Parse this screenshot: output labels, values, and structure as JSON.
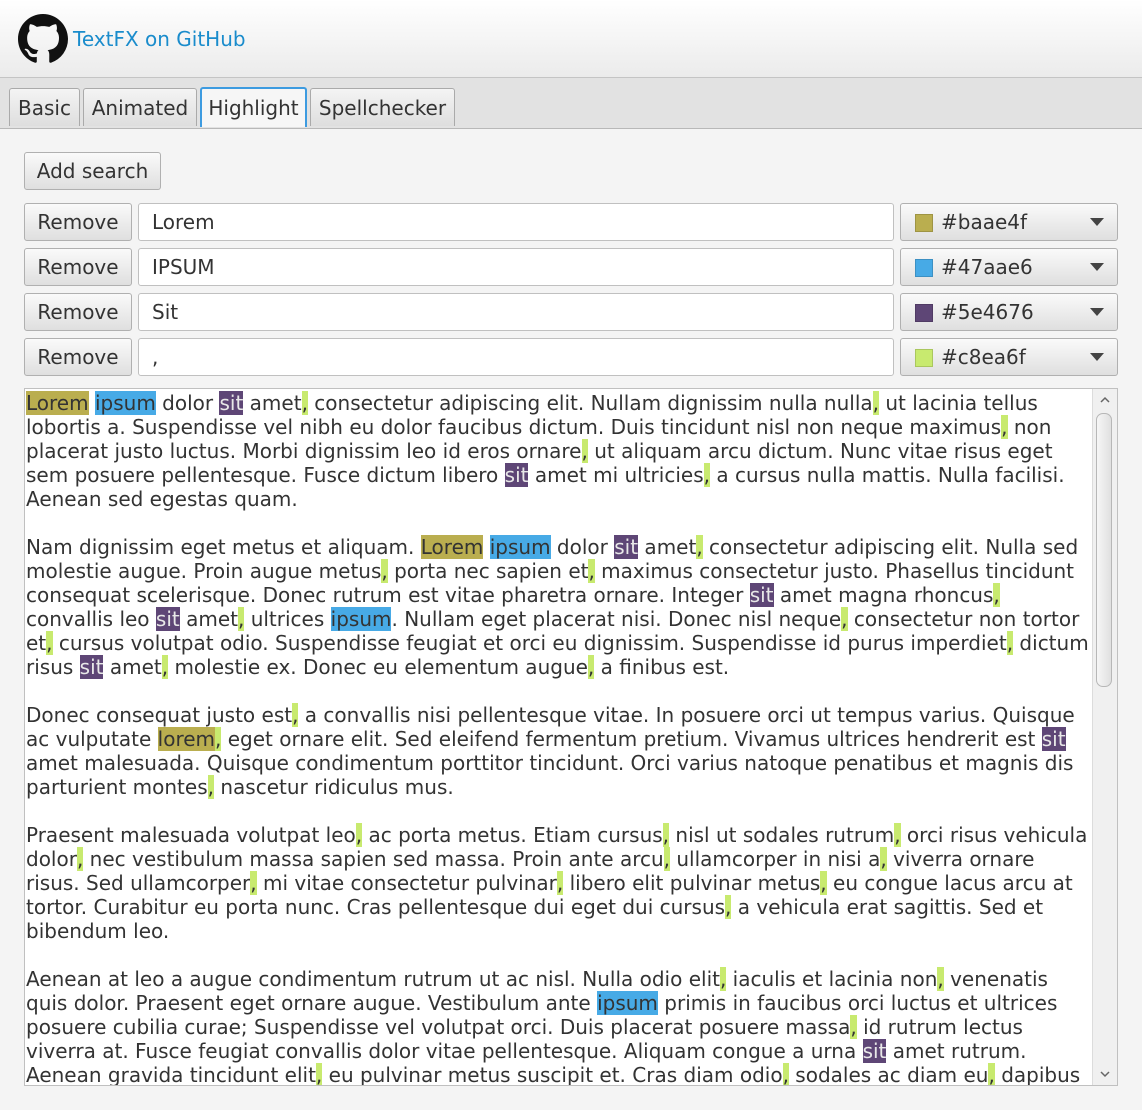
{
  "header": {
    "link_label": "TextFX on GitHub"
  },
  "tabs": [
    {
      "label": "Basic"
    },
    {
      "label": "Animated"
    },
    {
      "label": "Highlight"
    },
    {
      "label": "Spellchecker"
    }
  ],
  "active_tab": "Highlight",
  "controls": {
    "add_search_label": "Add search",
    "remove_label": "Remove"
  },
  "searches": [
    {
      "term": "Lorem",
      "color": "#baae4f"
    },
    {
      "term": "IPSUM",
      "color": "#47aae6"
    },
    {
      "term": "Sit",
      "color": "#5e4676"
    },
    {
      "term": ",",
      "color": "#c8ea6f"
    }
  ],
  "text_area": {
    "paragraphs": [
      "Lorem ipsum dolor sit amet, consectetur adipiscing elit. Nullam dignissim nulla nulla, ut lacinia tellus lobortis a. Suspendisse vel nibh eu dolor faucibus dictum. Duis tincidunt nisl non neque maximus, non placerat justo luctus. Morbi dignissim leo id eros ornare, ut aliquam arcu dictum. Nunc vitae risus eget sem posuere pellentesque. Fusce dictum libero sit amet mi ultricies, a cursus nulla mattis. Nulla facilisi. Aenean sed egestas quam.",
      "Nam dignissim eget metus et aliquam. Lorem ipsum dolor sit amet, consectetur adipiscing elit. Nulla sed molestie augue. Proin augue metus, porta nec sapien et, maximus consectetur justo. Phasellus tincidunt consequat scelerisque. Donec rutrum est vitae pharetra ornare. Integer sit amet magna rhoncus, convallis leo sit amet, ultrices ipsum. Nullam eget placerat nisi. Donec nisl neque, consectetur non tortor et, cursus volutpat odio. Suspendisse feugiat et orci eu dignissim. Suspendisse id purus imperdiet, dictum risus sit amet, molestie ex. Donec eu elementum augue, a finibus est.",
      "Donec consequat justo est, a convallis nisi pellentesque vitae. In posuere orci ut tempus varius. Quisque ac vulputate lorem, eget ornare elit. Sed eleifend fermentum pretium. Vivamus ultrices hendrerit est sit amet malesuada. Quisque condimentum porttitor tincidunt. Orci varius natoque penatibus et magnis dis parturient montes, nascetur ridiculus mus.",
      "Praesent malesuada volutpat leo, ac porta metus. Etiam cursus, nisl ut sodales rutrum, orci risus vehicula dolor, nec vestibulum massa sapien sed massa. Proin ante arcu, ullamcorper in nisi a, viverra ornare risus. Sed ullamcorper, mi vitae consectetur pulvinar, libero elit pulvinar metus, eu congue lacus arcu at tortor. Curabitur eu porta nunc. Cras pellentesque dui eget dui cursus, a vehicula erat sagittis. Sed et bibendum leo.",
      "Aenean at leo a augue condimentum rutrum ut ac nisl. Nulla odio elit, iaculis et lacinia non, venenatis quis dolor. Praesent eget ornare augue. Vestibulum ante ipsum primis in faucibus orci luctus et ultrices posuere cubilia curae; Suspendisse vel volutpat orci. Duis placerat posuere massa, id rutrum lectus viverra at. Fusce feugiat convallis dolor vitae pellentesque. Aliquam congue a urna sit amet rutrum. Aenean gravida tincidunt elit, eu pulvinar metus suscipit et. Cras diam odio, sodales ac diam eu, dapibus dictum nunc. Proin congue"
    ]
  }
}
